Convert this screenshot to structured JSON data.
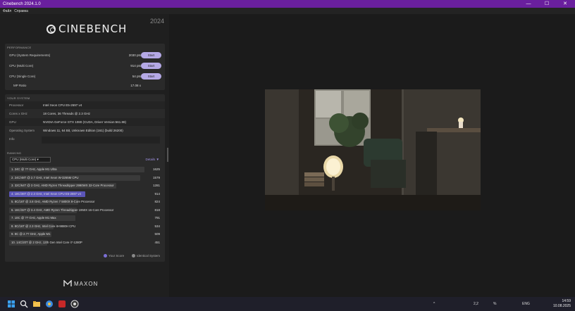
{
  "window": {
    "title": "Cinebench 2024.1.0",
    "minimize": "—",
    "maximize": "☐",
    "close": "✕"
  },
  "menu": [
    "Файл",
    "Справка"
  ],
  "brand": {
    "name": "CINEBENCH",
    "year": "2024",
    "footer": "MAXON"
  },
  "performance": {
    "header": "PERFORMANCE",
    "rows": [
      {
        "label": "GPU (System Requirements)",
        "points": "2030 pts",
        "button": "Start"
      },
      {
        "label": "CPU (Multi Core)",
        "points": "914 pts",
        "button": "Start"
      },
      {
        "label": "CPU (Single Core)",
        "points": "54 pts",
        "button": "Start"
      }
    ],
    "mp_ratio_label": "MP Ratio",
    "mp_ratio_value": "17.08 x"
  },
  "system": {
    "header": "YOUR SYSTEM",
    "rows": [
      {
        "key": "Processor",
        "value": "Intel Xeon CPU E5-2697 v4"
      },
      {
        "key": "Cores x GHz",
        "value": "18 Cores, 36 Threads @ 2.3 GHz"
      },
      {
        "key": "GPU",
        "value": "NVIDIA GeForce GTX 1080 (CUDA, Driver Version:561.88)"
      },
      {
        "key": "Operating System",
        "value": "Windows 11, 64 Bit, Unknown Edition (161) (build 26200)"
      },
      {
        "key": "Info",
        "value": ""
      }
    ]
  },
  "ranking": {
    "header": "RANKING",
    "select": "CPU (Multi Core)",
    "details": "Details",
    "rows": [
      {
        "name": "1. 24C @ ?? GHz, Apple M1 Ultra",
        "score": "1625",
        "fraction": 1.0,
        "highlight": false
      },
      {
        "name": "2. 24C/48T @ 2.7 GHz, Intel Xeon W-3265M CPU",
        "score": "1579",
        "fraction": 0.97,
        "highlight": false
      },
      {
        "name": "3. 32C/64T @ 3 GHz, AMD Ryzen Threadripper 2990WX 32-Core Processor",
        "score": "1281",
        "fraction": 0.79,
        "highlight": false
      },
      {
        "name": "4. 18C/36T @ 2.3 GHz, Intel Xeon CPU E5-2697 v4",
        "score": "914",
        "fraction": 0.56,
        "highlight": true
      },
      {
        "name": "5. 8C/16T @ 3.8 GHz, AMD Ryzen 7 5800X 8-Core Processor",
        "score": "824",
        "fraction": 0.51,
        "highlight": false
      },
      {
        "name": "6. 16C/32T @ 3.4 GHz, AMD Ryzen Threadripper 1950X 16-Core Processor",
        "score": "818",
        "fraction": 0.5,
        "highlight": false
      },
      {
        "name": "7. 10C @ ?? GHz, Apple M1 Max",
        "score": "791",
        "fraction": 0.49,
        "highlight": false
      },
      {
        "name": "8. 8C/16T @ 2.3 GHz, Intel Core i9-9880H CPU",
        "score": "534",
        "fraction": 0.33,
        "highlight": false
      },
      {
        "name": "9. 8C @ 2.?? GHz, Apple M1",
        "score": "509",
        "fraction": 0.31,
        "highlight": false
      },
      {
        "name": "10. 14C/20T @ 2 GHz, 12th Gen Intel Core i7-1280P",
        "score": "451",
        "fraction": 0.28,
        "highlight": false
      }
    ],
    "legend_yours": "Your Score",
    "legend_identical": "Identical System",
    "colors": {
      "yours": "#7b6fd6",
      "identical": "#8a8a8a"
    }
  },
  "taskbar": {
    "tray": [
      "^",
      "ENG",
      "2,2",
      "%"
    ],
    "time": "14:59",
    "date": "10.08.2025"
  }
}
